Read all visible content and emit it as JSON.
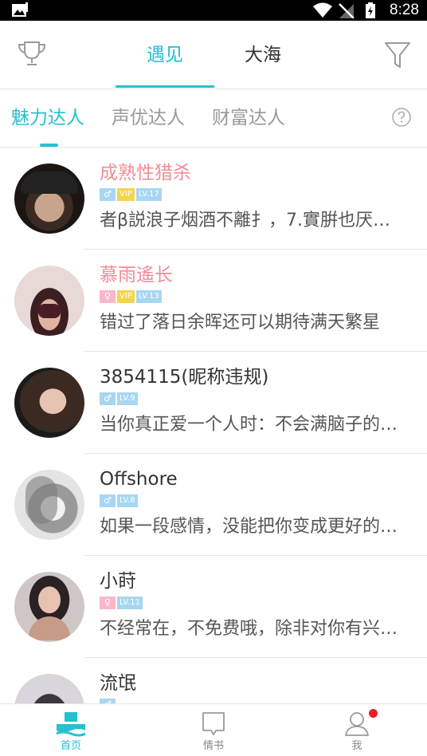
{
  "status_bar": {
    "time": "8:28"
  },
  "header": {
    "tabs": [
      {
        "label": "遇见"
      },
      {
        "label": "大海"
      }
    ],
    "accent": "#26c0d0"
  },
  "sub_tabs": [
    {
      "label": "魅力达人"
    },
    {
      "label": "声优达人"
    },
    {
      "label": "财富达人"
    }
  ],
  "users": [
    {
      "name": "成熟性猎杀",
      "name_color": "#f28c98",
      "sex": "♂",
      "sex_type": "male",
      "vip": "VIP",
      "level": "LV.17",
      "message": "者β説浪子烟酒不離扌，7.實腁也厌…"
    },
    {
      "name": "慕雨遙长",
      "name_color": "#f28c98",
      "sex": "♀",
      "sex_type": "female",
      "vip": "VIP",
      "level": "LV.13",
      "message": "错过了落日余晖还可以期待满天繁星"
    },
    {
      "name": "3854115(昵称违规)",
      "name_color": "#333333",
      "sex": "♂",
      "sex_type": "male",
      "vip": "",
      "level": "LV.9",
      "message": "当你真正爱一个人时：不会满脑子的…"
    },
    {
      "name": "Offshore",
      "name_color": "#333333",
      "sex": "♂",
      "sex_type": "male",
      "vip": "",
      "level": "LV.8",
      "message": "如果一段感情，没能把你变成更好的…"
    },
    {
      "name": "小莳",
      "name_color": "#333333",
      "sex": "♀",
      "sex_type": "female",
      "vip": "",
      "level": "LV.11",
      "message": "不经常在，不免费哦，除非对你有兴…"
    },
    {
      "name": "流氓",
      "name_color": "#333333",
      "sex": "♂",
      "sex_type": "male",
      "vip": "",
      "level": "",
      "message": ""
    }
  ],
  "bottom_nav": [
    {
      "label": "首页"
    },
    {
      "label": "情书"
    },
    {
      "label": "我"
    }
  ],
  "icons": [
    "trophy-icon",
    "filter-icon",
    "help-icon",
    "home-icon",
    "letter-icon",
    "profile-icon"
  ]
}
